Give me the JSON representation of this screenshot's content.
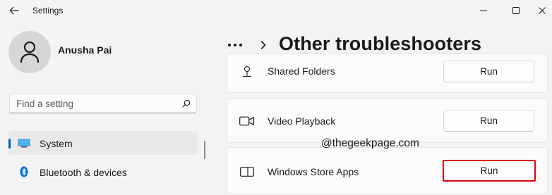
{
  "window": {
    "title": "Settings"
  },
  "user": {
    "name": "Anusha Pai"
  },
  "search": {
    "placeholder": "Find a setting"
  },
  "sidebar": {
    "items": [
      {
        "label": "System",
        "icon": "display-icon",
        "selected": true
      },
      {
        "label": "Bluetooth & devices",
        "icon": "bluetooth-icon",
        "selected": false
      }
    ]
  },
  "header": {
    "breadcrumb_more": "...",
    "title": "Other troubleshooters"
  },
  "troubleshooters": [
    {
      "label": "Shared Folders",
      "icon": "shared-folder-icon",
      "button": "Run"
    },
    {
      "label": "Video Playback",
      "icon": "video-camera-icon",
      "button": "Run"
    },
    {
      "label": "Windows Store Apps",
      "icon": "store-apps-icon",
      "button": "Run",
      "highlighted": true
    }
  ],
  "watermark": "@thegeekpage.com",
  "colors": {
    "accent": "#005fb8",
    "highlight_border": "#e0000f",
    "background": "#f3f3f3",
    "card": "#fbfbfb"
  }
}
